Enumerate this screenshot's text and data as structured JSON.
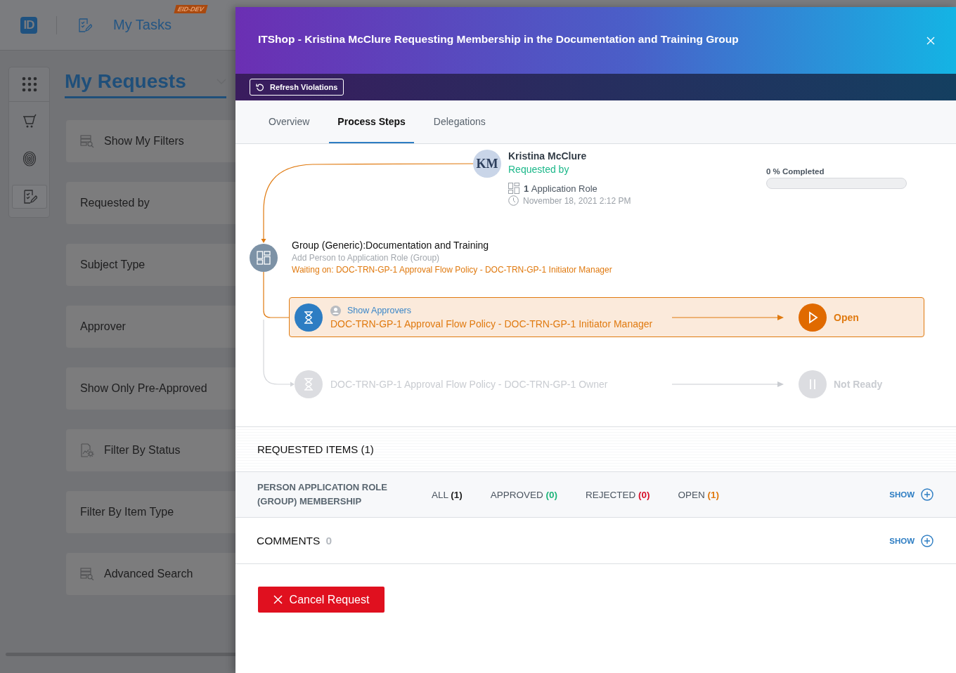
{
  "app": {
    "logo": "ID",
    "title": "My Tasks",
    "badge": "EID-DEV"
  },
  "rail": [
    {
      "kind": "apps",
      "selected": false
    },
    {
      "kind": "cart",
      "selected": false
    },
    {
      "kind": "fingerprint",
      "selected": false
    },
    {
      "kind": "tasks",
      "selected": true
    }
  ],
  "page": {
    "title": "My Requests"
  },
  "filters": [
    {
      "label": "Show My Filters",
      "kind": "search"
    },
    {
      "label": "Requested by",
      "kind": "plain"
    },
    {
      "label": "Subject Type",
      "kind": "plain"
    },
    {
      "label": "Approver",
      "kind": "plain"
    },
    {
      "label": "Show Only Pre-Approved",
      "kind": "plain"
    },
    {
      "label": "Filter By Status",
      "kind": "status"
    },
    {
      "label": "Filter By Item Type",
      "kind": "plain"
    },
    {
      "label": "Advanced Search",
      "kind": "search"
    }
  ],
  "dialog": {
    "title": "ITShop - Kristina McClure Requesting Membership in the Documentation and Training Group",
    "refresh_button": "Refresh Violations",
    "tabs": [
      {
        "label": "Overview",
        "selected": false
      },
      {
        "label": "Process Steps",
        "selected": true
      },
      {
        "label": "Delegations",
        "selected": false
      }
    ]
  },
  "requester": {
    "initials": "KM",
    "name": "Kristina McClure",
    "role": "Requested by",
    "count": "1",
    "item_type": "Application Role",
    "date": "November 18, 2021 2:12 PM"
  },
  "progress": {
    "label": "0 % Completed",
    "level": 0
  },
  "group": {
    "title": "Group (Generic):Documentation and Training",
    "subtitle": "Add Person to Application Role (Group)",
    "waiting": "Waiting on: DOC-TRN-GP-1 Approval Flow Policy - DOC-TRN-GP-1 Initiator Manager"
  },
  "steps": [
    {
      "kind": "active",
      "link": "Show Approvers",
      "name": "DOC-TRN-GP-1 Approval Flow Policy - DOC-TRN-GP-1 Initiator Manager",
      "status": "Open"
    },
    {
      "kind": "pending",
      "name": "DOC-TRN-GP-1 Approval Flow Policy - DOC-TRN-GP-1 Owner",
      "status": "Not Ready"
    }
  ],
  "requested_items": {
    "title": "REQUESTED ITEMS (1)",
    "rows": [
      {
        "type": "PERSON APPLICATION ROLE (GROUP) MEMBERSHIP",
        "action": "SHOW",
        "counts": [
          {
            "label": "ALL",
            "value": "(1)",
            "color": "#222222"
          },
          {
            "label": "APPROVED",
            "value": "(0)",
            "color": "#1fb57a"
          },
          {
            "label": "REJECTED",
            "value": "(0)",
            "color": "#d8102a"
          },
          {
            "label": "OPEN",
            "value": "(1)",
            "color": "#e07a10"
          }
        ]
      }
    ]
  },
  "comments": {
    "title": "COMMENTS",
    "count": "0",
    "action": "SHOW"
  },
  "cancel_button": "Cancel Request"
}
